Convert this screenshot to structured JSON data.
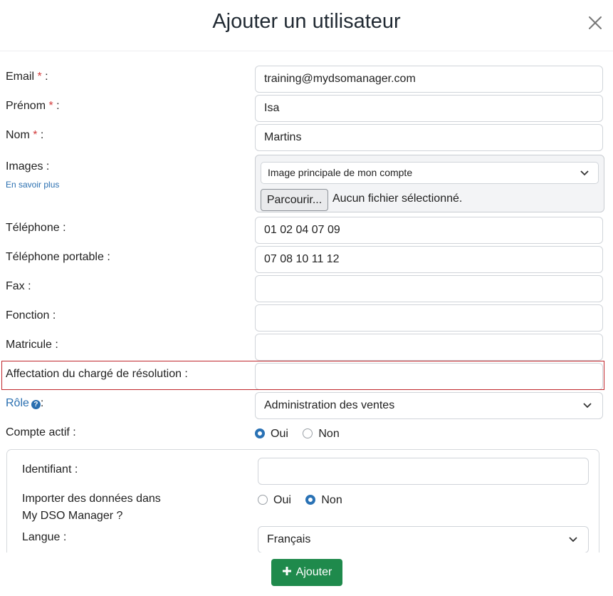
{
  "modal": {
    "title": "Ajouter un utilisateur"
  },
  "fields": {
    "email": {
      "label": "Email",
      "suffix": " :",
      "value": "training@mydsomanager.com"
    },
    "firstname": {
      "label": "Prénom",
      "suffix": " :",
      "value": "Isa"
    },
    "lastname": {
      "label": "Nom",
      "suffix": " :",
      "value": "Martins"
    },
    "images": {
      "label": "Images :",
      "learn_more": "En savoir plus",
      "select_value": "Image principale de mon compte",
      "browse_label": "Parcourir...",
      "no_file": "Aucun fichier sélectionné."
    },
    "phone": {
      "label": "Téléphone :",
      "value": "01 02 04 07 09"
    },
    "mobile": {
      "label": "Téléphone portable :",
      "value": "07 08 10 11 12"
    },
    "fax": {
      "label": "Fax :",
      "value": ""
    },
    "function": {
      "label": "Fonction :",
      "value": ""
    },
    "employee_id": {
      "label": "Matricule :",
      "value": ""
    },
    "assignment": {
      "label": "Affectation du chargé de résolution :",
      "value": ""
    },
    "role": {
      "label": "Rôle",
      "suffix": ":",
      "value": "Administration des ventes"
    },
    "active": {
      "label": "Compte actif :",
      "yes": "Oui",
      "no": "Non",
      "selected": "yes"
    }
  },
  "required_marker": "*",
  "panel": {
    "identifier": {
      "label": "Identifiant :",
      "value": ""
    },
    "import": {
      "label_line1": "Importer des données dans",
      "label_line2": "My DSO Manager ?",
      "yes": "Oui",
      "no": "Non",
      "selected": "no"
    },
    "language": {
      "label": "Langue :",
      "value": "Français"
    }
  },
  "footer": {
    "add_label": "Ajouter"
  },
  "colors": {
    "primary": "#2a72b5",
    "success": "#1f8a4c",
    "required": "#d23a3a",
    "highlight": "#c0272d"
  }
}
